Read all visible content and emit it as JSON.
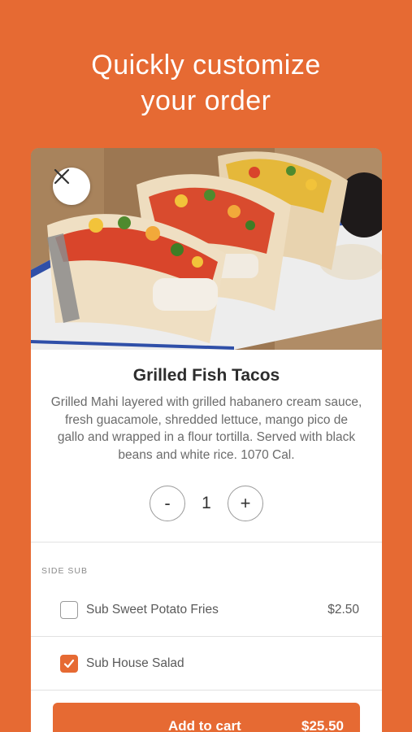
{
  "header": {
    "line1": "Quickly customize",
    "line2": "your order"
  },
  "item": {
    "image_alt": "Grilled Fish Tacos photo",
    "title": "Grilled Fish Tacos",
    "description": "Grilled Mahi layered with grilled habanero cream sauce, fresh guacamole, shredded lettuce, mango pico de gallo and wrapped in a flour tortilla. Served with black beans and white rice. 1070 Cal.",
    "close_icon": "close-icon"
  },
  "quantity": {
    "minus_label": "-",
    "value": "1",
    "plus_label": "+"
  },
  "side_sub": {
    "section_label": "SIDE SUB",
    "options": [
      {
        "label": "Sub Sweet Potato Fries",
        "price": "$2.50",
        "checked": false
      },
      {
        "label": "Sub House Salad",
        "price": "",
        "checked": true
      }
    ]
  },
  "cart": {
    "add_label": "Add to cart",
    "total": "$25.50"
  },
  "colors": {
    "brand": "#E66A33",
    "card": "#FFFFFF",
    "title_text": "#2D2D2D",
    "body_text": "#6B6B6B"
  }
}
